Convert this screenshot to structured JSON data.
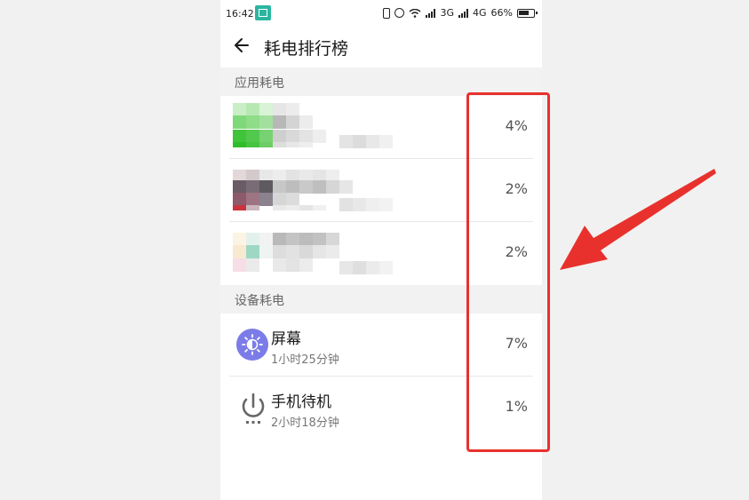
{
  "status_bar": {
    "time": "16:42",
    "network_3g": "3G",
    "network_4g": "4G",
    "battery": "66%",
    "icons": [
      "scan-icon",
      "vibrate-icon",
      "alarm-icon",
      "wifi-icon",
      "signal-icon",
      "battery-icon"
    ]
  },
  "header": {
    "title": "耗电排行榜",
    "back_icon": "back-arrow-icon"
  },
  "sections": {
    "app": {
      "label": "应用耗电"
    },
    "device": {
      "label": "设备耗电"
    }
  },
  "app_items": [
    {
      "percent": "4%"
    },
    {
      "percent": "2%"
    },
    {
      "percent": "2%"
    }
  ],
  "device_items": [
    {
      "name": "屏幕",
      "duration": "1小时25分钟",
      "percent": "7%",
      "icon": "brightness-icon"
    },
    {
      "name": "手机待机",
      "duration": "2小时18分钟",
      "percent": "1%",
      "icon": "power-icon"
    }
  ],
  "annotation": {
    "highlight_color": "#e8312d"
  }
}
